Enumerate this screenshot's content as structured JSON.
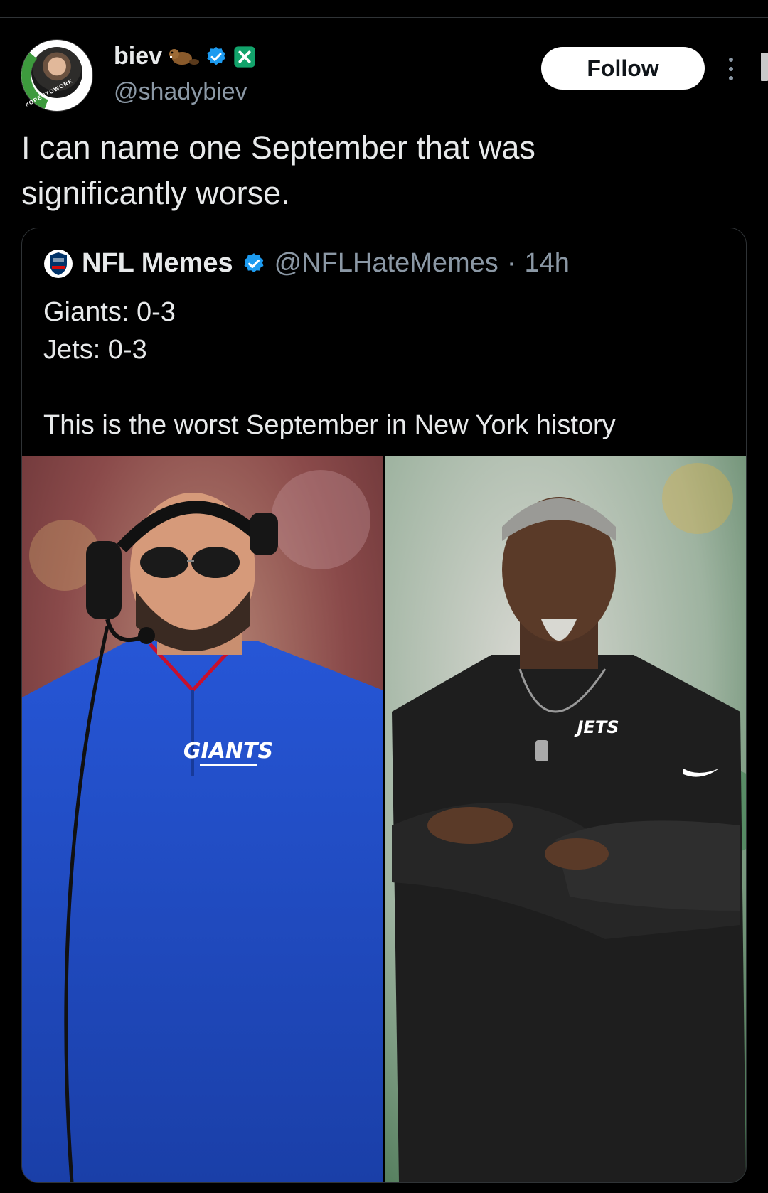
{
  "author": {
    "display_name": "biev",
    "handle": "@shadybiev",
    "avatar_badge_text": "#OPENTOWORK"
  },
  "actions": {
    "follow_label": "Follow"
  },
  "tweet": {
    "text": "I can name one September that was\nsignificantly worse."
  },
  "quoted": {
    "display_name": "NFL Memes",
    "handle": "@NFLHateMemes",
    "separator": "·",
    "time": "14h",
    "lines": [
      "Giants: 0-3",
      "Jets: 0-3",
      "",
      "This is the worst September in New York history"
    ],
    "media": {
      "left_jersey_text": "GIANTS",
      "right_jersey_text": "JETS"
    }
  },
  "colors": {
    "background": "#000000",
    "text": "#e7e9ea",
    "muted": "#8b98a5",
    "verified": "#1d9bf0",
    "x_badge": "#12a36b",
    "giants_blue": "#1f4bc8"
  },
  "icons": {
    "beaver": "beaver-icon",
    "verified": "verified-badge-icon",
    "x_badge": "x-affiliate-badge-icon",
    "more": "more-vertical-icon"
  }
}
